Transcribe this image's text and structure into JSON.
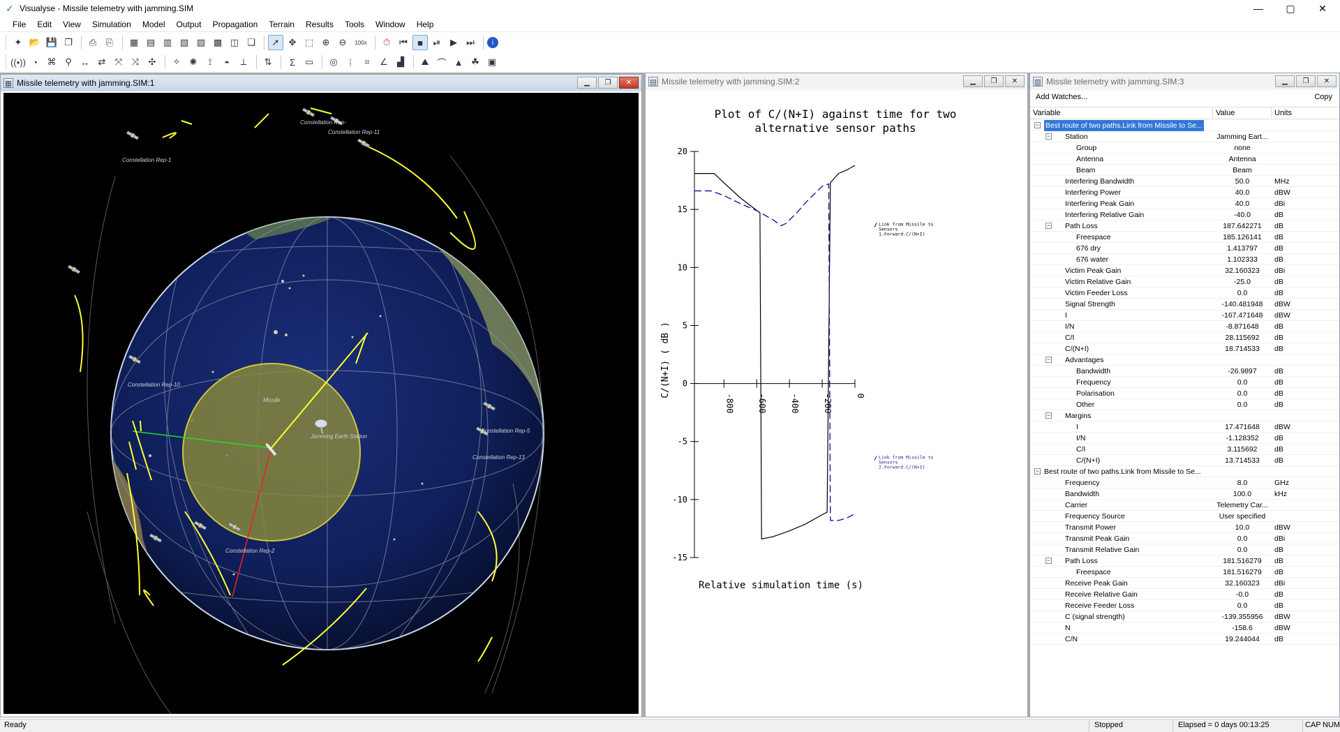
{
  "app": {
    "title": "Visualyse - Missile telemetry with jamming.SIM",
    "window_controls": {
      "minimize": "—",
      "maximize": "▢",
      "close": "✕"
    }
  },
  "menu": [
    "File",
    "Edit",
    "View",
    "Simulation",
    "Model",
    "Output",
    "Propagation",
    "Terrain",
    "Results",
    "Tools",
    "Window",
    "Help"
  ],
  "toolbar1": {
    "zoom_label": "100x"
  },
  "windows": {
    "globe": {
      "title": "Missile telemetry with jamming.SIM:1",
      "labels": {
        "rep_top": "Constellation Rep-",
        "rep11": "Constellation Rep-11",
        "rep1": "Constellation Rep-1",
        "rep10": "Constellation Rep-10",
        "rep5": "Constellation Rep-5",
        "rep13": "Constellation Rep-13",
        "rep2": "Constellation Rep-2",
        "missile": "Missile",
        "earth_station": "Jamming Earth Station"
      },
      "colors": {
        "ocean": "#0f1f5a",
        "coverage": "#8a8a3a",
        "orbit": "#ffff33",
        "link_green": "#22dd22",
        "link_red": "#ee2222",
        "link_yellow": "#ffff33"
      }
    },
    "plot": {
      "title": "Missile telemetry with jamming.SIM:2",
      "legend1": [
        "Link from Missile to",
        "Sensors",
        "1.Forward.C/(N+I)"
      ],
      "legend2": [
        "Link from Missile to",
        "Sensors",
        "2.Forward.C/(N+I)"
      ]
    },
    "watch": {
      "title": "Missile telemetry with jamming.SIM:3",
      "add_watches": "Add Watches...",
      "copy": "Copy",
      "columns": {
        "variable": "Variable",
        "value": "Value",
        "units": "Units"
      },
      "rows": [
        {
          "level": 0,
          "expander": "−",
          "name": "Best route of two paths.Link from Missile to Se...",
          "value": "",
          "units": "",
          "selected": true
        },
        {
          "level": 1,
          "expander": "−",
          "name": "Station",
          "value": "Jamming Eart...",
          "units": ""
        },
        {
          "level": 2,
          "name": "Group",
          "value": "none",
          "units": ""
        },
        {
          "level": 2,
          "name": "Antenna",
          "value": "Antenna",
          "units": ""
        },
        {
          "level": 2,
          "name": "Beam",
          "value": "Beam",
          "units": ""
        },
        {
          "level": 1,
          "name": "Interfering Bandwidth",
          "value": "50.0",
          "units": "MHz"
        },
        {
          "level": 1,
          "name": "Interfering Power",
          "value": "40.0",
          "units": "dBW"
        },
        {
          "level": 1,
          "name": "Interfering Peak Gain",
          "value": "40.0",
          "units": "dBi"
        },
        {
          "level": 1,
          "name": "Interfering Relative Gain",
          "value": "-40.0",
          "units": "dB"
        },
        {
          "level": 1,
          "expander": "−",
          "name": "Path Loss",
          "value": "187.642271",
          "units": "dB"
        },
        {
          "level": 2,
          "name": "Freespace",
          "value": "185.126141",
          "units": "dB"
        },
        {
          "level": 2,
          "name": "676 dry",
          "value": "1.413797",
          "units": "dB"
        },
        {
          "level": 2,
          "name": "676 water",
          "value": "1.102333",
          "units": "dB"
        },
        {
          "level": 1,
          "name": "Victim Peak Gain",
          "value": "32.160323",
          "units": "dBi"
        },
        {
          "level": 1,
          "name": "Victim Relative Gain",
          "value": "-25.0",
          "units": "dB"
        },
        {
          "level": 1,
          "name": "Victim Feeder Loss",
          "value": "0.0",
          "units": "dB"
        },
        {
          "level": 1,
          "name": "Signal Strength",
          "value": "-140.481948",
          "units": "dBW"
        },
        {
          "level": 1,
          "name": "I",
          "value": "-167.471648",
          "units": "dBW"
        },
        {
          "level": 1,
          "name": "I/N",
          "value": "-8.871648",
          "units": "dB"
        },
        {
          "level": 1,
          "name": "C/I",
          "value": "28.115692",
          "units": "dB"
        },
        {
          "level": 1,
          "name": "C/(N+I)",
          "value": "18.714533",
          "units": "dB"
        },
        {
          "level": 1,
          "expander": "−",
          "name": "Advantages",
          "value": "",
          "units": ""
        },
        {
          "level": 2,
          "name": "Bandwidth",
          "value": "-26.9897",
          "units": "dB"
        },
        {
          "level": 2,
          "name": "Frequency",
          "value": "0.0",
          "units": "dB"
        },
        {
          "level": 2,
          "name": "Polarisation",
          "value": "0.0",
          "units": "dB"
        },
        {
          "level": 2,
          "name": "Other",
          "value": "0.0",
          "units": "dB"
        },
        {
          "level": 1,
          "expander": "−",
          "name": "Margins",
          "value": "",
          "units": ""
        },
        {
          "level": 2,
          "name": "I",
          "value": "17.471648",
          "units": "dBW"
        },
        {
          "level": 2,
          "name": "I/N",
          "value": "-1.128352",
          "units": "dB"
        },
        {
          "level": 2,
          "name": "C/I",
          "value": "3.115692",
          "units": "dB"
        },
        {
          "level": 2,
          "name": "C/(N+I)",
          "value": "13.714533",
          "units": "dB"
        },
        {
          "level": 0,
          "expander": "−",
          "name": "Best route of two paths.Link from Missile to Se...",
          "value": "",
          "units": ""
        },
        {
          "level": 1,
          "name": "Frequency",
          "value": "8.0",
          "units": "GHz"
        },
        {
          "level": 1,
          "name": "Bandwidth",
          "value": "100.0",
          "units": "kHz"
        },
        {
          "level": 1,
          "name": "Carrier",
          "value": "Telemetry Car...",
          "units": ""
        },
        {
          "level": 1,
          "name": "Frequency Source",
          "value": "User specified",
          "units": ""
        },
        {
          "level": 1,
          "name": "Transmit Power",
          "value": "10.0",
          "units": "dBW"
        },
        {
          "level": 1,
          "name": "Transmit Peak Gain",
          "value": "0.0",
          "units": "dBi"
        },
        {
          "level": 1,
          "name": "Transmit Relative Gain",
          "value": "0.0",
          "units": "dB"
        },
        {
          "level": 1,
          "expander": "−",
          "name": "Path Loss",
          "value": "181.516279",
          "units": "dB"
        },
        {
          "level": 2,
          "name": "Freespace",
          "value": "181.516279",
          "units": "dB"
        },
        {
          "level": 1,
          "name": "Receive Peak Gain",
          "value": "32.160323",
          "units": "dBi"
        },
        {
          "level": 1,
          "name": "Receive Relative Gain",
          "value": "-0.0",
          "units": "dB"
        },
        {
          "level": 1,
          "name": "Receive Feeder Loss",
          "value": "0.0",
          "units": "dB"
        },
        {
          "level": 1,
          "name": "C (signal strength)",
          "value": "-139.355956",
          "units": "dBW"
        },
        {
          "level": 1,
          "name": "N",
          "value": "-158.6",
          "units": "dBW"
        },
        {
          "level": 1,
          "name": "C/N",
          "value": "19.244044",
          "units": "dB"
        }
      ]
    }
  },
  "status": {
    "left": "Ready",
    "state": "Stopped",
    "elapsed": "Elapsed = 0 days 00:13:25",
    "cap": "CAP",
    "num": "NUM"
  },
  "chart_data": {
    "type": "line",
    "title": "Plot of C/(N+I) against time for two alternative sensor paths",
    "xlabel": "Relative simulation time (s)",
    "ylabel": "C/(N+I) ( dB )",
    "xlim": [
      -980,
      0
    ],
    "ylim": [
      -15,
      20
    ],
    "x_ticks": [
      -800,
      -600,
      -400,
      -200,
      0
    ],
    "y_ticks": [
      20,
      15,
      10,
      5,
      0,
      -5,
      -10,
      -15
    ],
    "grid": false,
    "series": [
      {
        "name": "Link from Missile to Sensors 1.Forward.C/(N+I)",
        "style": "solid",
        "color": "#000000",
        "x": [
          -980,
          -860,
          -800,
          -700,
          -580,
          -570,
          -500,
          -400,
          -300,
          -200,
          -170,
          -150,
          -100,
          -50,
          0
        ],
        "y": [
          18.1,
          18.1,
          17.3,
          16.0,
          14.7,
          -13.4,
          -13.2,
          -12.7,
          -12.1,
          -11.3,
          -11.1,
          17.3,
          18.1,
          18.4,
          18.8
        ]
      },
      {
        "name": "Link from Missile to Sensors 2.Forward.C/(N+I)",
        "style": "dashed",
        "color": "#1a1aa0",
        "x": [
          -980,
          -880,
          -800,
          -700,
          -600,
          -500,
          -450,
          -420,
          -350,
          -300,
          -250,
          -200,
          -160,
          -150,
          -100,
          -50,
          -10
        ],
        "y": [
          16.6,
          16.6,
          16.2,
          15.5,
          14.9,
          14.1,
          13.6,
          13.8,
          14.8,
          15.6,
          16.3,
          17.0,
          17.2,
          -11.8,
          -11.8,
          -11.6,
          -11.3
        ]
      }
    ]
  }
}
